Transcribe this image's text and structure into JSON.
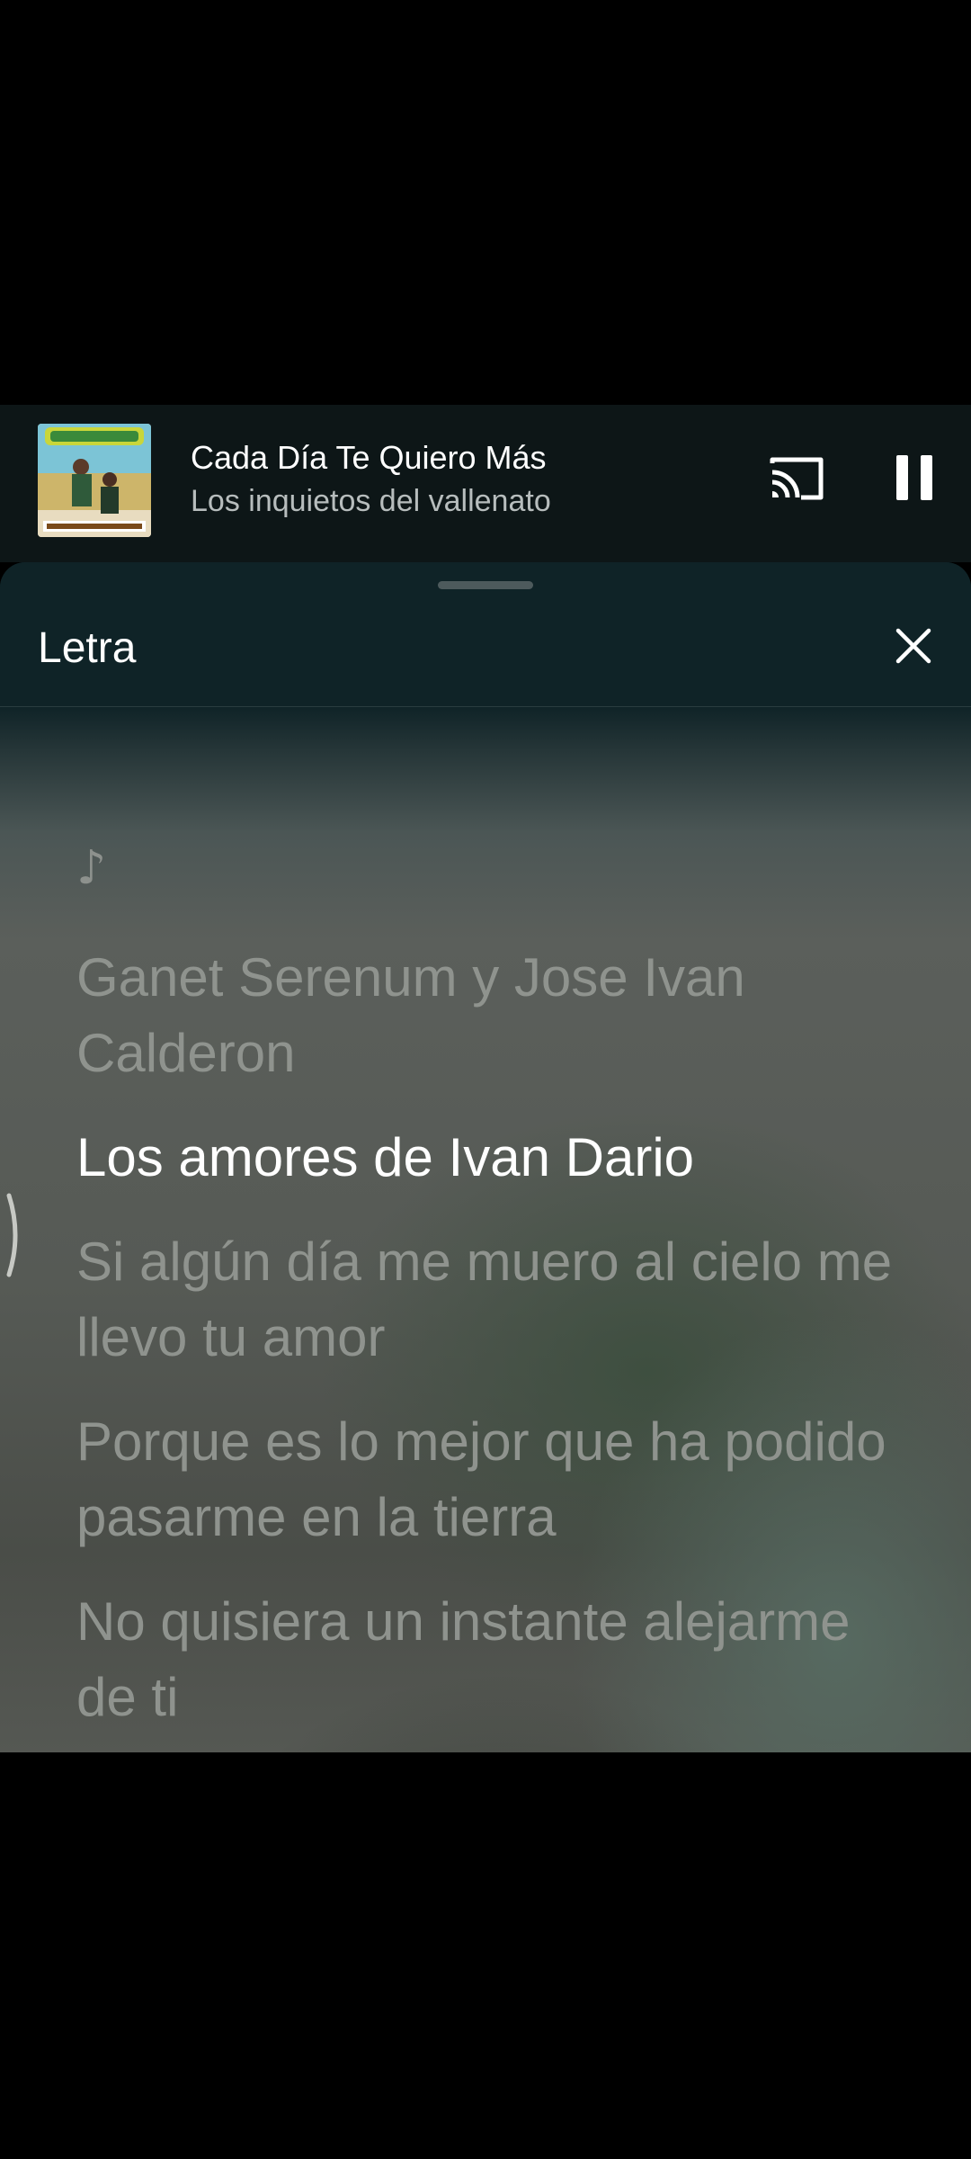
{
  "player": {
    "title": "Cada Día Te Quiero Más",
    "artist": "Los inquietos del vallenato",
    "album_art_icon": "album-cover",
    "cast_icon": "cast-icon",
    "pause_icon": "pause-icon"
  },
  "lyrics_sheet": {
    "title": "Letra",
    "close_icon": "close-icon",
    "note_symbol": "♪",
    "lines": [
      "Ganet Serenum y Jose Ivan Calderon",
      "Los amores de Ivan Dario",
      "Si algún día me muero al cielo me llevo tu amor",
      "Porque es lo mejor que ha podido pasarme en la tierra",
      "No quisiera un instante alejarme de ti"
    ],
    "active_line_index": 1
  },
  "colors": {
    "mini_player_bg": "#0d1617",
    "sheet_header_bg": "#0f2327",
    "active_lyric": "#ffffff",
    "inactive_lyric": "#8f938e"
  }
}
